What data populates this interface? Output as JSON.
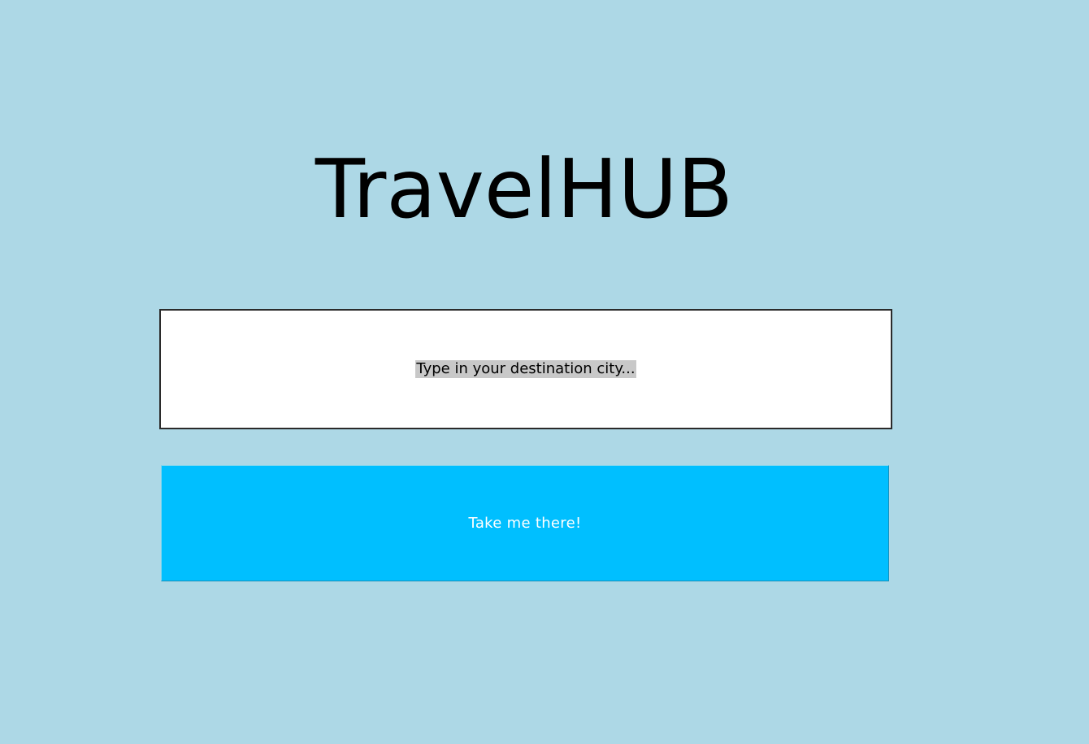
{
  "app": {
    "title": "TravelHUB"
  },
  "search": {
    "placeholder": "Type in your destination city..."
  },
  "action": {
    "button_label": "Take me there!"
  },
  "colors": {
    "background": "#add8e6",
    "button": "#00bfff",
    "button_text": "#ffffff",
    "input_background": "#ffffff",
    "placeholder_highlight": "#c8c8c8"
  },
  "icons": []
}
